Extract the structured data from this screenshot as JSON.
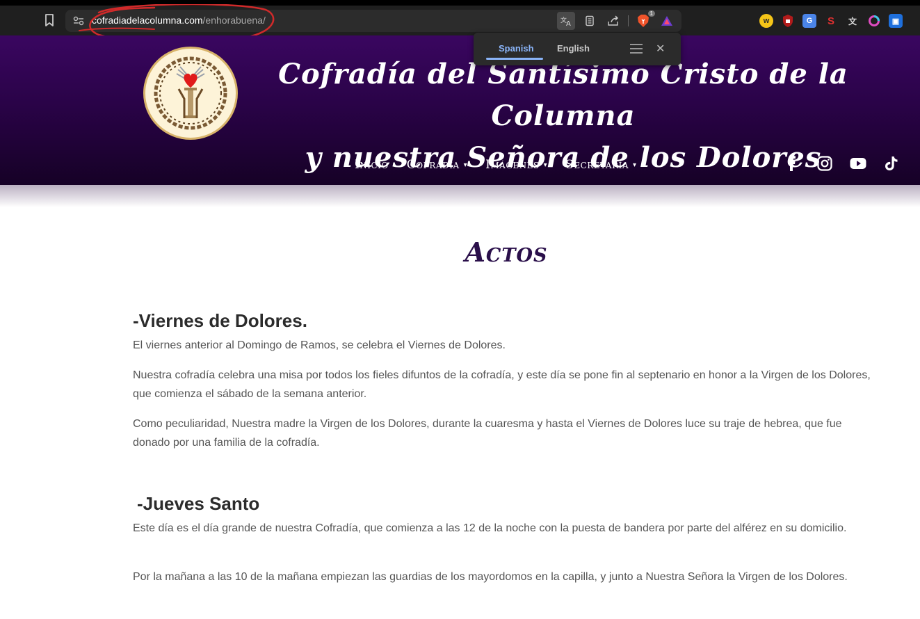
{
  "browser": {
    "url_host": "cofradiadelacolumna.com",
    "url_path": "/enhorabuena/",
    "brave_badge": "1",
    "annotation_color": "#d12a2a"
  },
  "translate_popup": {
    "tabs": [
      "Spanish",
      "English"
    ],
    "active_tab": "Spanish"
  },
  "header": {
    "title_line1": "Cofradía del Santísimo Cristo de la Columna",
    "title_line2": "y nuestra Señora de los Dolores",
    "nav": [
      {
        "label": "Inicio",
        "has_dropdown": false
      },
      {
        "label": "Cofradía",
        "has_dropdown": true
      },
      {
        "label": "Imágenes",
        "has_dropdown": true
      },
      {
        "label": "Secretaría",
        "has_dropdown": true
      }
    ],
    "social": [
      "facebook-icon",
      "instagram-icon",
      "youtube-icon",
      "tiktok-icon"
    ],
    "colors": {
      "header_top": "#3a0660",
      "header_bottom": "#160126"
    }
  },
  "content": {
    "heading": "Actos",
    "sections": [
      {
        "title": "-Viernes de Dolores.",
        "paragraphs": [
          "El viernes anterior al Domingo de Ramos, se celebra el Viernes de Dolores.",
          "Nuestra cofradía celebra una misa por todos los fieles difuntos de la cofradía, y este día se pone fin al septenario en honor a la Virgen de los Dolores, que comienza el sábado de la semana anterior.",
          "Como peculiaridad, Nuestra madre la Virgen de los Dolores, durante la cuaresma y hasta el Viernes de Dolores luce su traje de hebrea, que fue donado por una familia de la cofradía."
        ]
      },
      {
        "title": "-Jueves Santo",
        "paragraphs": [
          "Este día es el día grande de nuestra Cofradía, que comienza a las 12 de la noche con la puesta de bandera por parte del alférez en su domicilio.",
          "Por la mañana a las 10 de la mañana empiezan las guardias de los mayordomos en la capilla, y junto a Nuestra Señora la Virgen de los Dolores."
        ]
      }
    ]
  }
}
